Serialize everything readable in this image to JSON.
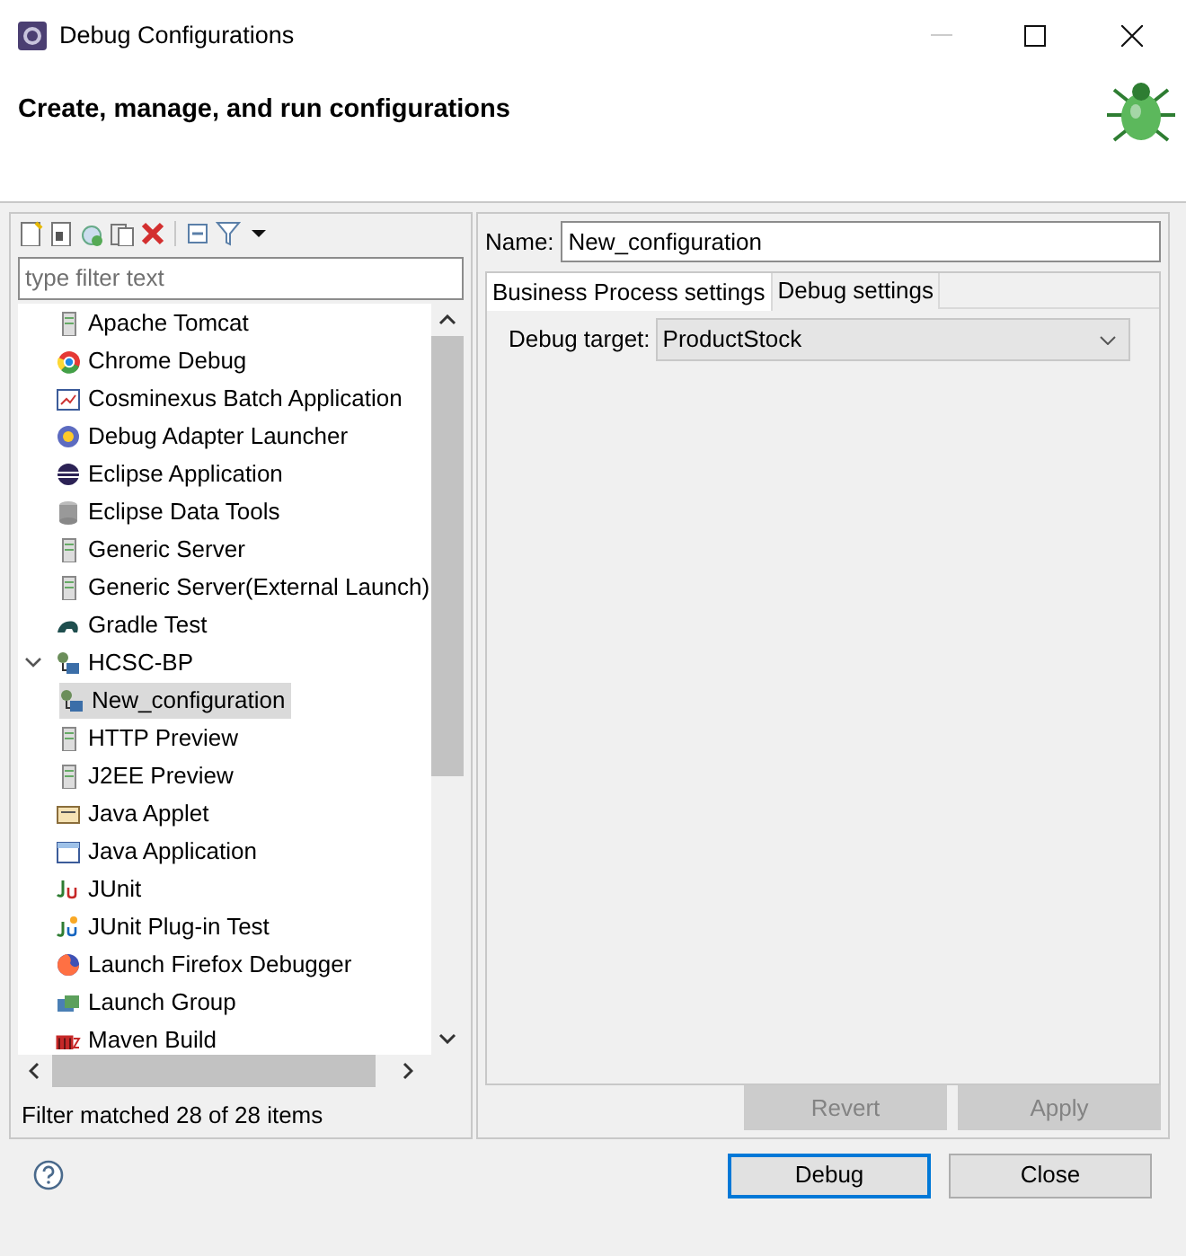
{
  "window": {
    "title": "Debug Configurations"
  },
  "header": {
    "title": "Create, manage, and run configurations"
  },
  "filter": {
    "placeholder": "type filter text"
  },
  "tree": [
    {
      "label": "Apache Tomcat",
      "selected": false
    },
    {
      "label": "Chrome Debug",
      "selected": false
    },
    {
      "label": "Cosminexus Batch Application",
      "selected": false
    },
    {
      "label": "Debug Adapter Launcher",
      "selected": false
    },
    {
      "label": "Eclipse Application",
      "selected": false
    },
    {
      "label": "Eclipse Data Tools",
      "selected": false
    },
    {
      "label": "Generic Server",
      "selected": false
    },
    {
      "label": "Generic Server(External Launch)",
      "selected": false
    },
    {
      "label": "Gradle Test",
      "selected": false
    },
    {
      "label": "HCSC-BP",
      "selected": false,
      "expanded": true,
      "children": [
        {
          "label": "New_configuration",
          "selected": true
        }
      ]
    },
    {
      "label": "HTTP Preview",
      "selected": false
    },
    {
      "label": "J2EE Preview",
      "selected": false
    },
    {
      "label": "Java Applet",
      "selected": false
    },
    {
      "label": "Java Application",
      "selected": false
    },
    {
      "label": "JUnit",
      "selected": false
    },
    {
      "label": "JUnit Plug-in Test",
      "selected": false
    },
    {
      "label": "Launch Firefox Debugger",
      "selected": false
    },
    {
      "label": "Launch Group",
      "selected": false
    },
    {
      "label": "Maven Build",
      "selected": false
    }
  ],
  "filter_status": "Filter matched 28 of 28 items",
  "name": {
    "label": "Name:",
    "value": "New_configuration"
  },
  "tabs": [
    {
      "label": "Business Process settings",
      "selected": true
    },
    {
      "label": "Debug settings",
      "selected": false
    }
  ],
  "debug_target": {
    "label": "Debug target:",
    "value": "ProductStock"
  },
  "panel_buttons": [
    {
      "label": "Revert",
      "disabled": true
    },
    {
      "label": "Apply",
      "disabled": true
    }
  ],
  "buttons": [
    {
      "label": "Debug",
      "default": true
    },
    {
      "label": "Close",
      "default": false
    }
  ]
}
